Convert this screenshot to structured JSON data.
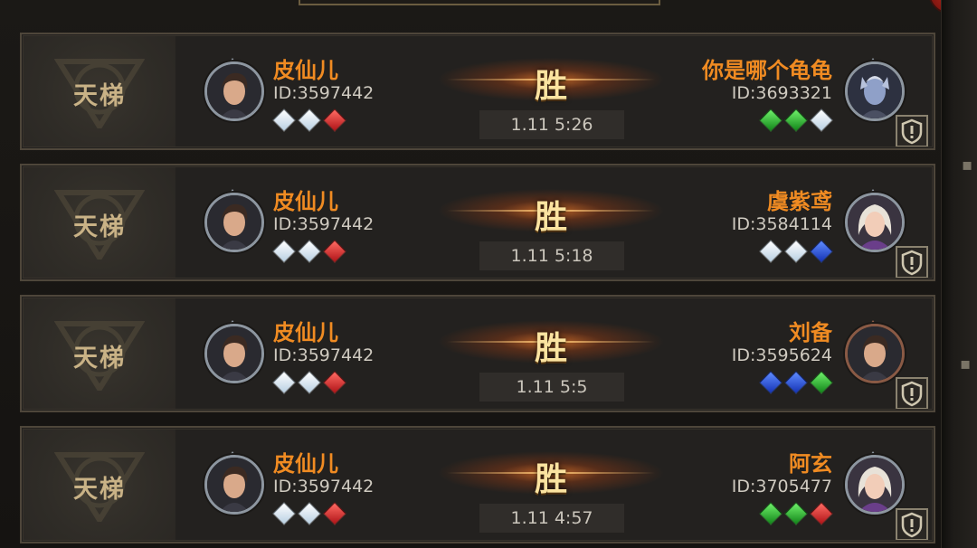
{
  "matches": [
    {
      "mode": "天梯",
      "left": {
        "name": "皮仙儿",
        "id": "ID:3597442",
        "gems": [
          "white",
          "white",
          "red"
        ],
        "avatar": "male-hero-avatar"
      },
      "result": "胜",
      "time": "1.11  5:26",
      "right": {
        "name": "你是哪个龟龟",
        "id": "ID:3693321",
        "gems": [
          "green",
          "green",
          "white"
        ],
        "avatar": "undead-hero-avatar"
      }
    },
    {
      "mode": "天梯",
      "left": {
        "name": "皮仙儿",
        "id": "ID:3597442",
        "gems": [
          "white",
          "white",
          "red"
        ],
        "avatar": "male-hero-avatar"
      },
      "result": "胜",
      "time": "1.11  5:18",
      "right": {
        "name": "虞紫鸢",
        "id": "ID:3584114",
        "gems": [
          "white",
          "white",
          "blue"
        ],
        "avatar": "female-hero-avatar"
      }
    },
    {
      "mode": "天梯",
      "left": {
        "name": "皮仙儿",
        "id": "ID:3597442",
        "gems": [
          "white",
          "white",
          "red"
        ],
        "avatar": "male-hero-avatar"
      },
      "result": "胜",
      "time": "1.11  5:5",
      "right": {
        "name": "刘备",
        "id": "ID:3595624",
        "gems": [
          "blue",
          "blue",
          "green"
        ],
        "avatar": "male-hero-avatar"
      }
    },
    {
      "mode": "天梯",
      "left": {
        "name": "皮仙儿",
        "id": "ID:3597442",
        "gems": [
          "white",
          "white",
          "red"
        ],
        "avatar": "male-hero-avatar"
      },
      "result": "胜",
      "time": "1.11  4:57",
      "right": {
        "name": "阿玄",
        "id": "ID:3705477",
        "gems": [
          "green",
          "green",
          "red"
        ],
        "avatar": "female-hero-avatar"
      }
    }
  ],
  "colors": {
    "name": "#f08b22",
    "result": "#fbe3a0",
    "mode_label": "#c9b286",
    "gem_white": "#e6f0f8",
    "gem_red": "#d8262c",
    "gem_green": "#2bbf36",
    "gem_blue": "#2b53e0"
  },
  "icons": {
    "report": "report-icon",
    "mode_emblem": "ladder-emblem-icon"
  }
}
